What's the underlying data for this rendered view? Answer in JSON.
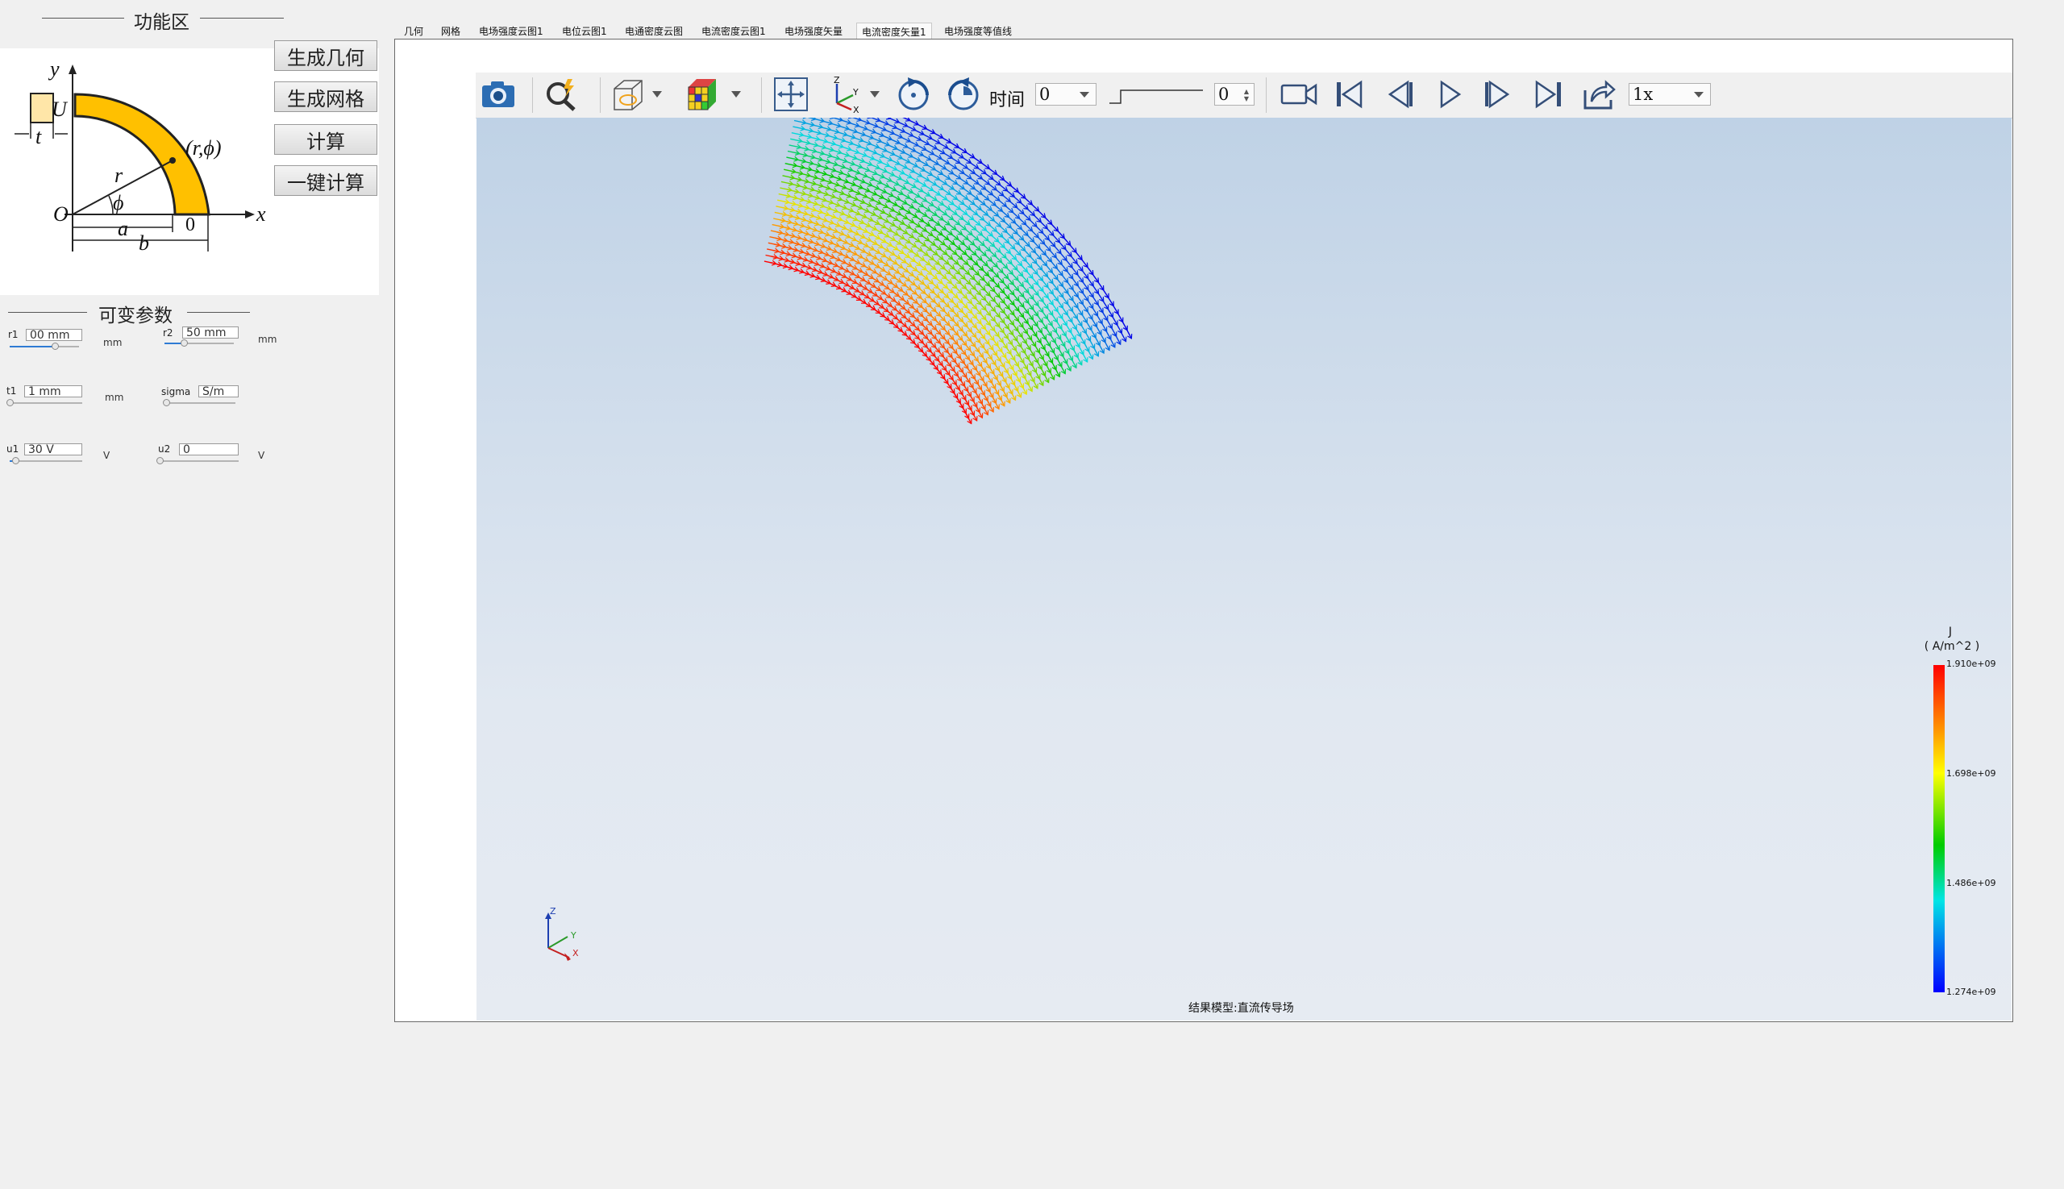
{
  "left_panel": {
    "function_title": "功能区",
    "buttons": {
      "generate_geometry": "生成几何",
      "generate_mesh": "生成网格",
      "compute": "计算",
      "one_click_compute": "一键计算"
    },
    "diagram_labels": {
      "y": "y",
      "x": "x",
      "U": "U",
      "t": "t",
      "r": "r",
      "r_phi": "(r,ϕ)",
      "phi": "ϕ",
      "O": "O",
      "a": "a",
      "b": "b",
      "zero": "0"
    },
    "params_title": "可变参数",
    "params": [
      {
        "label": "r1",
        "value": "00  mm",
        "unit": "mm",
        "level": 0.65
      },
      {
        "label": "r2",
        "value": "50  mm",
        "unit": "mm",
        "level": 0.28
      },
      {
        "label": "t1",
        "value": "1  mm",
        "unit": "mm",
        "level": 0.0
      },
      {
        "label": "sigma",
        "value": "S/m",
        "unit": "",
        "level": 0.0
      },
      {
        "label": "u1",
        "value": "30  V",
        "unit": "V",
        "level": 0.08
      },
      {
        "label": "u2",
        "value": "0",
        "unit": "V",
        "level": 0.0
      }
    ]
  },
  "tabs": [
    {
      "label": "几何",
      "active": false
    },
    {
      "label": "网格",
      "active": false
    },
    {
      "label": "电场强度云图1",
      "active": false
    },
    {
      "label": "电位云图1",
      "active": false
    },
    {
      "label": "电通密度云图",
      "active": false
    },
    {
      "label": "电流密度云图1",
      "active": false
    },
    {
      "label": "电场强度矢量",
      "active": false
    },
    {
      "label": "电流密度矢量1",
      "active": true
    },
    {
      "label": "电场强度等值线",
      "active": false
    }
  ],
  "toolbar": {
    "icons": [
      "camera-icon",
      "zoom-icon",
      "box-display-icon",
      "color-cube-icon",
      "fit-view-icon",
      "axes-orientation-icon",
      "rotate-cw-icon",
      "rotate-ccw-icon",
      "record-video-icon",
      "first-frame-icon",
      "prev-frame-icon",
      "play-icon",
      "next-frame-icon",
      "last-frame-icon",
      "export-icon"
    ],
    "time_label": "时间",
    "time_value": "0",
    "frame_value": "0",
    "speed_value": "1x"
  },
  "legend": {
    "title_symbol": "J",
    "title_unit": "( A/m^2 )",
    "ticks": [
      "1.910e+09",
      "1.698e+09",
      "1.486e+09",
      "1.274e+09"
    ]
  },
  "axes_triad": {
    "z": "Z",
    "y": "Y",
    "x": "X"
  },
  "status_text": "结果模型:直流传导场"
}
